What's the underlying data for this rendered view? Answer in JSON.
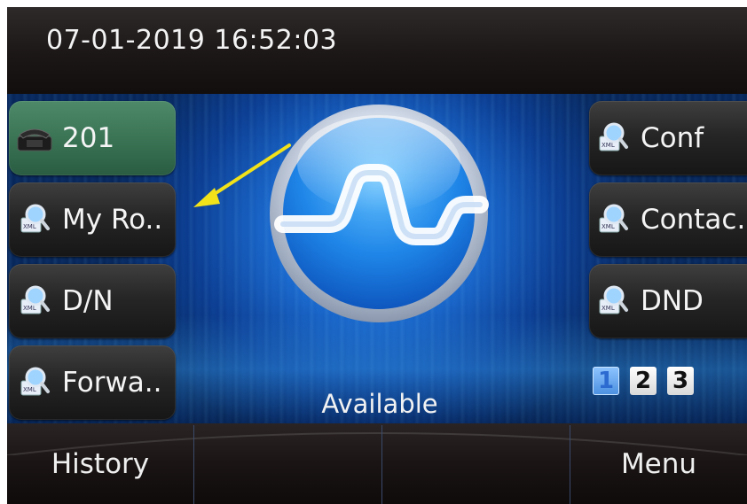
{
  "status_bar": {
    "datetime": "07-01-2019 16:52:03"
  },
  "left_keys": [
    {
      "label": "201",
      "icon": "phone-icon",
      "active": true
    },
    {
      "label": "My Ro..",
      "icon": "xml-magnifier-icon"
    },
    {
      "label": "D/N",
      "icon": "xml-magnifier-icon"
    },
    {
      "label": "Forwa..",
      "icon": "xml-magnifier-icon"
    }
  ],
  "right_keys": [
    {
      "label": "Conf",
      "icon": "xml-magnifier-icon"
    },
    {
      "label": "Contac.",
      "icon": "xml-magnifier-icon"
    },
    {
      "label": "DND",
      "icon": "xml-magnifier-icon"
    }
  ],
  "center": {
    "status": "Available"
  },
  "pages": [
    "1",
    "2",
    "3"
  ],
  "active_page": "1",
  "softkeys": [
    {
      "label": "History"
    },
    {
      "label": ""
    },
    {
      "label": ""
    },
    {
      "label": "Menu"
    }
  ],
  "colors": {
    "line_key_active": "#3a7455",
    "annotation_arrow": "#f2e21a",
    "background_blue": "#1c6fd6"
  }
}
